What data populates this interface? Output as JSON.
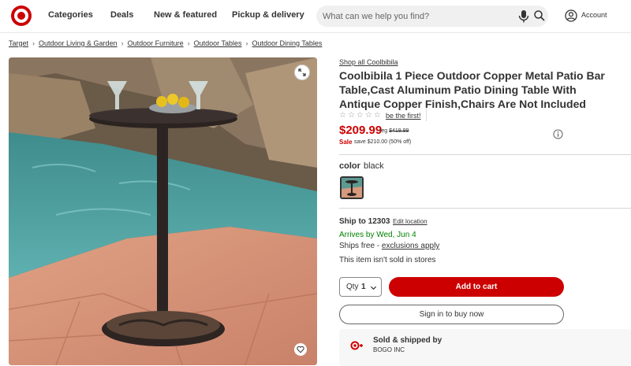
{
  "header": {
    "nav": [
      "Categories",
      "Deals",
      "New & featured",
      "Pickup & delivery"
    ],
    "search_placeholder": "What can we help you find?",
    "account_label": "Account"
  },
  "breadcrumb": [
    "Target",
    "Outdoor Living & Garden",
    "Outdoor Furniture",
    "Outdoor Tables",
    "Outdoor Dining Tables"
  ],
  "product": {
    "shop_all": "Shop all Coolbibila",
    "title": "Coolbibila 1 Piece Outdoor Copper Metal Patio Bar Table,Cast Aluminum Patio Dining Table With Antique Copper Finish,Chairs Are Not Included",
    "rating_stars": "☆☆☆☆☆",
    "rating_link": "be the first!",
    "price": "$209.99",
    "reg_label": "reg",
    "reg_price": "$419.99",
    "sale_label": "Sale",
    "save_text": "save $210.00 (50% off)",
    "color_label": "color",
    "color_value": "black"
  },
  "shipping": {
    "ship_to": "Ship to 12303",
    "edit_location": "Edit location",
    "arrives": "Arrives by Wed, Jun 4",
    "ships_free_prefix": "Ships free - ",
    "exclusions": "exclusions apply",
    "not_sold": "This item isn't sold in stores"
  },
  "purchase": {
    "qty_label": "Qty",
    "qty_value": "1",
    "add_to_cart": "Add to cart",
    "sign_in": "Sign in to buy now"
  },
  "seller": {
    "title": "Sold & shipped by",
    "name": "BOGO INC"
  },
  "colors": {
    "brand": "#cc0000",
    "in_stock": "#008300"
  },
  "icons": [
    "target-logo-icon",
    "microphone-icon",
    "search-icon",
    "account-icon",
    "expand-icon",
    "heart-icon",
    "info-icon",
    "chevron-down-icon",
    "target-plus-icon"
  ]
}
